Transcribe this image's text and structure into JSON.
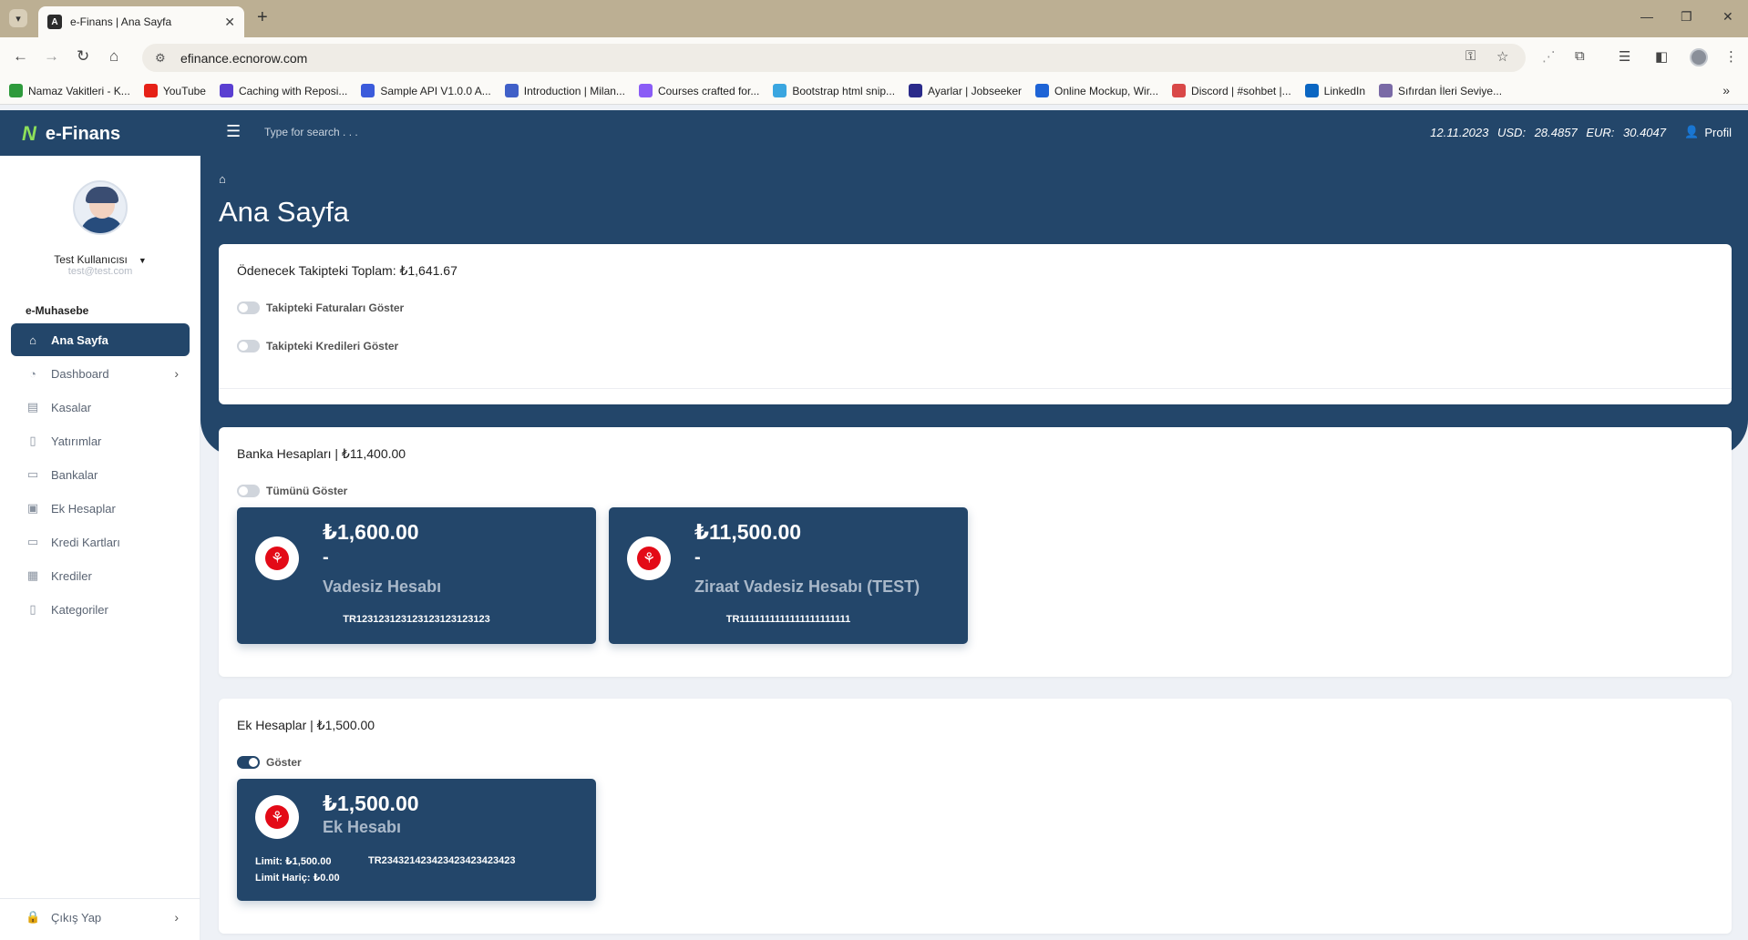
{
  "browser": {
    "tab_title": "e-Finans | Ana Sayfa",
    "tab_favicon": "A",
    "url": "efinance.ecnorow.com",
    "bookmarks": [
      {
        "label": "Namaz Vakitleri - K...",
        "color": "#2e9a3c"
      },
      {
        "label": "YouTube",
        "color": "#e62117"
      },
      {
        "label": "Caching with Reposi...",
        "color": "#5a3fd1"
      },
      {
        "label": "Sample API V1.0.0 A...",
        "color": "#3b5bdb"
      },
      {
        "label": "Introduction | Milan...",
        "color": "#4060c8"
      },
      {
        "label": "Courses crafted for...",
        "color": "#8a5cf6"
      },
      {
        "label": "Bootstrap html snip...",
        "color": "#3aa6e0"
      },
      {
        "label": "Ayarlar | Jobseeker",
        "color": "#2a2a8a"
      },
      {
        "label": "Online Mockup, Wir...",
        "color": "#1e64d6"
      },
      {
        "label": "Discord | #sohbet |...",
        "color": "#d94848"
      },
      {
        "label": "LinkedIn",
        "color": "#0a66c2"
      },
      {
        "label": "Sıfırdan İleri Seviye...",
        "color": "#7a6aa6"
      }
    ]
  },
  "header": {
    "brand": "e-Finans",
    "search_placeholder": "Type for search . . .",
    "date": "12.11.2023",
    "usd_label": "USD:",
    "usd_value": "28.4857",
    "eur_label": "EUR:",
    "eur_value": "30.4047",
    "profile_label": "Profil"
  },
  "page": {
    "title": "Ana Sayfa"
  },
  "sidebar": {
    "user_name": "Test Kullanıcısı",
    "user_email": "test@test.com",
    "section_title": "e-Muhasebe",
    "items": [
      {
        "label": "Ana Sayfa",
        "icon": "⌂"
      },
      {
        "label": "Dashboard",
        "icon": "◔"
      },
      {
        "label": "Kasalar",
        "icon": "▤"
      },
      {
        "label": "Yatırımlar",
        "icon": "▯"
      },
      {
        "label": "Bankalar",
        "icon": "▭"
      },
      {
        "label": "Ek Hesaplar",
        "icon": "▣"
      },
      {
        "label": "Kredi Kartları",
        "icon": "▭"
      },
      {
        "label": "Krediler",
        "icon": "▦"
      },
      {
        "label": "Kategoriler",
        "icon": "▯"
      }
    ],
    "logout_label": "Çıkış Yap"
  },
  "pending": {
    "title": "Ödenecek Takipteki Toplam: ₺1,641.67",
    "toggle_invoices": "Takipteki Faturaları Göster",
    "toggle_credits": "Takipteki Kredileri Göster"
  },
  "bank_accounts": {
    "title": "Banka Hesapları | ₺11,400.00",
    "toggle_all": "Tümünü Göster",
    "accounts": [
      {
        "amount": "₺1,600.00",
        "dash": "-",
        "name": "Vadesiz Hesabı",
        "iban": "TR123123123123123123123123"
      },
      {
        "amount": "₺11,500.00",
        "dash": "-",
        "name": "Ziraat Vadesiz Hesabı (TEST)",
        "iban": "TR1111111111111111111111"
      }
    ]
  },
  "extra_accounts": {
    "title": "Ek Hesaplar | ₺1,500.00",
    "toggle_show": "Göster",
    "account": {
      "amount": "₺1,500.00",
      "name": "Ek Hesabı",
      "limit": "Limit: ₺1,500.00",
      "limit_excluded": "Limit Hariç: ₺0.00",
      "iban": "TR234321423423423423423423"
    }
  },
  "colors": {
    "primary": "#23466a",
    "brand_logo": "#8de05a",
    "bank_red": "#e30a17"
  }
}
